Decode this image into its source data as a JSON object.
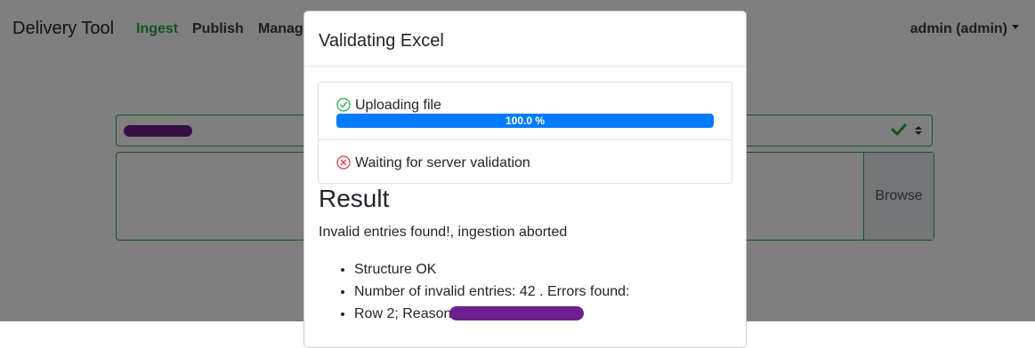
{
  "navbar": {
    "brand": "Delivery Tool",
    "links": [
      {
        "label": "Ingest",
        "active": true
      },
      {
        "label": "Publish",
        "active": false
      },
      {
        "label": "Manag",
        "active": false
      }
    ],
    "user_menu": "admin (admin)"
  },
  "ingest_form": {
    "browse_label": "Browse"
  },
  "modal": {
    "title": "Validating Excel",
    "steps": [
      {
        "label": "Uploading file",
        "status": "done",
        "progress": 100.0,
        "progress_label": "100.0 %"
      },
      {
        "label": "Waiting for server validation",
        "status": "error"
      }
    ],
    "result": {
      "heading": "Result",
      "message": "Invalid entries found!, ingestion aborted",
      "details": [
        "Structure OK",
        "Number of invalid entries: 42 . Errors found:",
        "Row 2; Reason:"
      ]
    }
  },
  "colors": {
    "active_nav": "#28a745",
    "valid_border": "#28a745",
    "progress": "#007bff",
    "success_icon": "#28a745",
    "error_icon": "#dc3545",
    "redaction": "#6c1f8e"
  }
}
